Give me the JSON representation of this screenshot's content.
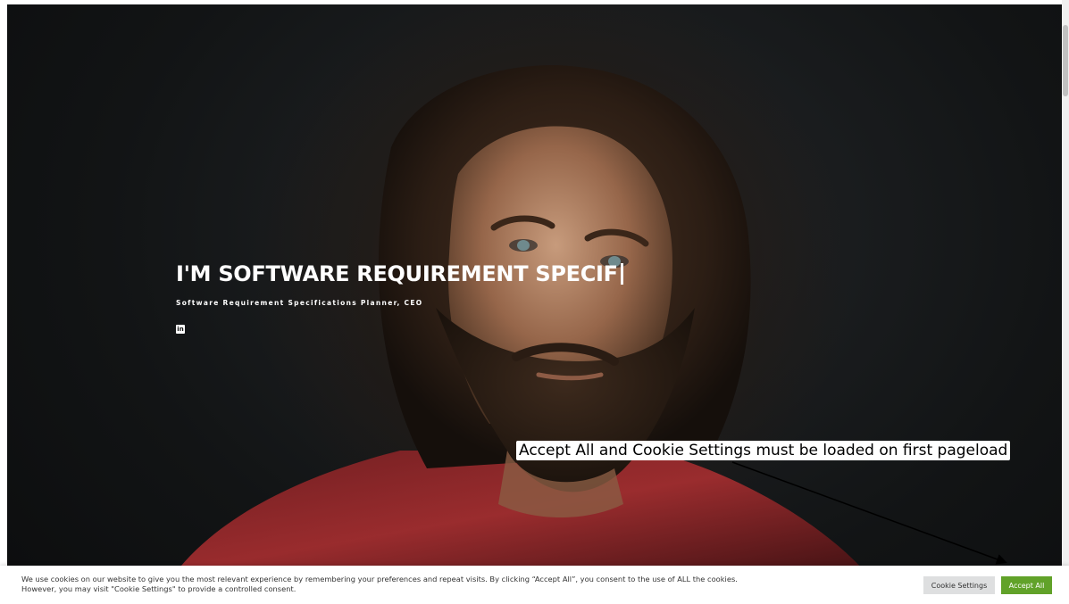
{
  "hero": {
    "title": "I'M SOFTWARE REQUIREMENT SPECIF",
    "subtitle": "Software Requirement Specifications Planner, CEO",
    "social_icon": "linkedin-icon",
    "linkedin_glyph": "in"
  },
  "annotation": {
    "text": "Accept All and Cookie Settings must be loaded on first pageload"
  },
  "cookie_bar": {
    "text": "We use cookies on our website to give you the most relevant experience by remembering your preferences and repeat visits. By clicking “Accept All”, you consent to the use of ALL the cookies. However, you may visit \"Cookie Settings\" to provide a controlled consent.",
    "settings_label": "Cookie Settings",
    "accept_label": "Accept All"
  },
  "colors": {
    "accept_button": "#61a229",
    "settings_button": "#dedfe0",
    "hero_background": "#121415"
  }
}
